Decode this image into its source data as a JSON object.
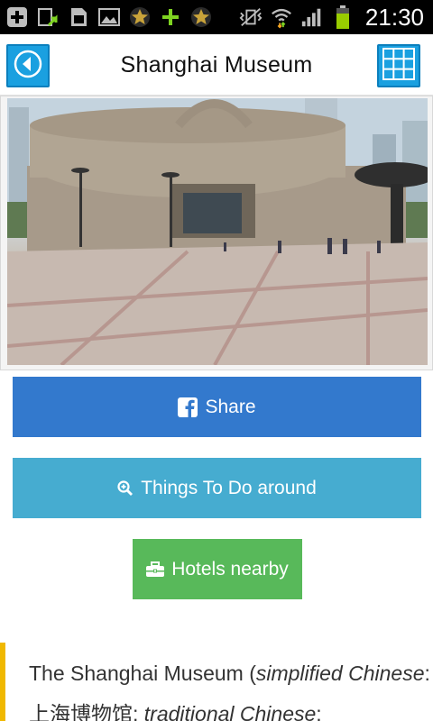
{
  "status_bar": {
    "time": "21:30",
    "left_icons": [
      "add-icon",
      "upload-icon",
      "sim-card-icon",
      "image-icon",
      "star-icon",
      "plus-icon",
      "star-icon"
    ],
    "right_icons": [
      "vibrate-icon",
      "wifi-icon",
      "signal-icon",
      "battery-icon"
    ]
  },
  "header": {
    "title": "Shanghai Museum",
    "back_icon": "back-arrow-icon",
    "menu_icon": "grid-menu-icon"
  },
  "photo": {
    "subject": "Shanghai Museum building"
  },
  "buttons": {
    "share": "Share",
    "things_to_do": "Things To Do around",
    "hotels": "Hotels nearby"
  },
  "description": {
    "part1": "The Shanghai Museum (",
    "part2": "simplified Chinese",
    "part3": ": 上海博物馆; ",
    "part4": "traditional Chinese",
    "part5": ":"
  },
  "colors": {
    "accent_blue": "#1aa0e0",
    "share_bg": "#3379cd",
    "todo_bg": "#46acd0",
    "hotels_bg": "#58b95a",
    "quote_bar": "#f0b800"
  }
}
